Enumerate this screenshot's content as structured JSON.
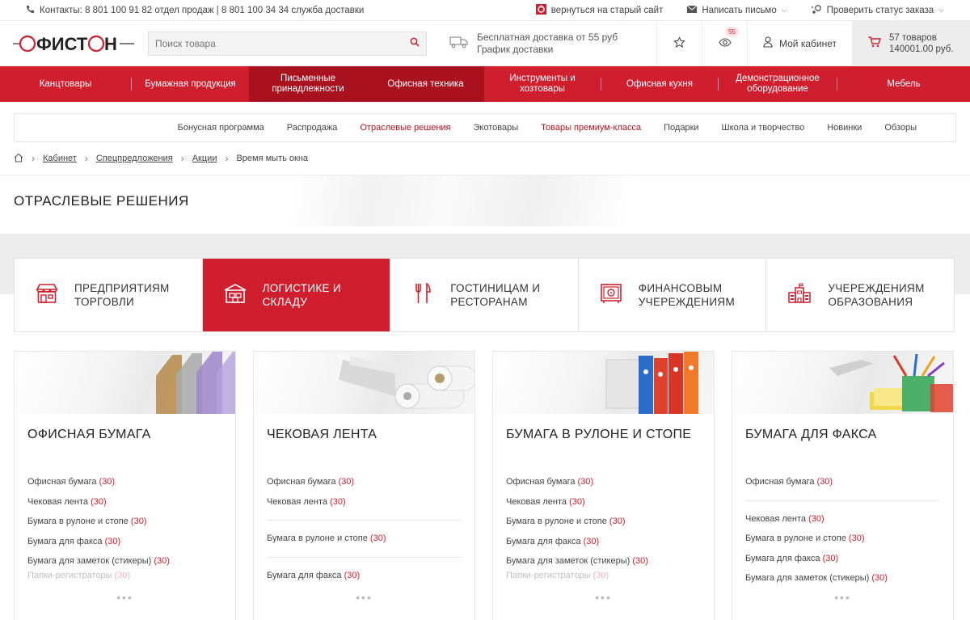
{
  "topbar": {
    "contacts": "Контакты: 8 801 100 91 82 отдел продаж  |  8 801 100 34 34 служба доставки",
    "old_site": "вернуться на старый сайт",
    "write_letter": "Написать письмо",
    "order_status": "Проверить статус заказа"
  },
  "header": {
    "logo_text": "ОФИСТОН",
    "search_placeholder": "Поиск товара",
    "delivery_line1": "Бесплатная доставка от 55 руб",
    "delivery_line2": "График доставки",
    "views_badge": "55",
    "cabinet": "Мой кабинет",
    "cart_count": "57 товаров",
    "cart_sum": "140001.00 руб."
  },
  "main_nav": [
    "Канцтовары",
    "Бумажная продукция",
    "Письменные принадлежности",
    "Офисная техника",
    "Инструменты и хозтовары",
    "Офисная кухня",
    "Демонстрационное оборудование",
    "Мебель"
  ],
  "sub_nav": [
    "Бонусная программа",
    "Распродажа",
    "Отраслевые решения",
    "Экотовары",
    "Товары премиум-класса",
    "Подарки",
    "Школа и творчество",
    "Новинки",
    "Обзоры"
  ],
  "breadcrumbs": [
    "Кабинет",
    "Спецпредложения",
    "Акции",
    "Время мыть окна"
  ],
  "page_title": "ОТРАСЛЕВЫЕ РЕШЕНИЯ",
  "segments": [
    {
      "line1": "ПРЕДПРИЯТИЯМ",
      "line2": "ТОРГОВЛИ",
      "icon": "shop-icon"
    },
    {
      "line1": "ЛОГИСТИКЕ И",
      "line2": "СКЛАДУ",
      "icon": "warehouse-icon"
    },
    {
      "line1": "ГОСТИНИЦАМ И",
      "line2": "РЕСТОРАНАМ",
      "icon": "cutlery-icon"
    },
    {
      "line1": "ФИНАНСОВЫМ",
      "line2": "УЧЕРЕЖДЕНИЯМ",
      "icon": "safe-icon"
    },
    {
      "line1": "УЧЕРЕЖДЕНИЯМ",
      "line2": "ОБРАЗОВАНИЯ",
      "icon": "school-icon"
    }
  ],
  "cards": [
    {
      "title": "ОФИСНАЯ БУМАГА",
      "items": [
        {
          "label": "Офисная бумага",
          "count": "(30)"
        },
        {
          "label": "Чековая лента",
          "count": "(30)"
        },
        {
          "label": "Бумага в рулоне и стопе",
          "count": "(30)"
        },
        {
          "label": "Бумага для факса",
          "count": "(30)"
        },
        {
          "label": "Бумага для заметок (стикеры)",
          "count": "(30)"
        },
        {
          "label": "Папки-регистраторы",
          "count": "(30)"
        }
      ]
    },
    {
      "title": "ЧЕКОВАЯ ЛЕНТА",
      "items": [
        {
          "label": "Офисная бумага",
          "count": "(30)"
        },
        {
          "label": "Чековая лента",
          "count": "(30)"
        },
        {
          "label": "Бумага в рулоне и стопе",
          "count": "(30)"
        },
        {
          "label": "Бумага для факса",
          "count": "(30)"
        }
      ]
    },
    {
      "title": "БУМАГА В РУЛОНЕ И СТОПЕ",
      "items": [
        {
          "label": "Офисная бумага",
          "count": "(30)"
        },
        {
          "label": "Чековая лента",
          "count": "(30)"
        },
        {
          "label": "Бумага в рулоне и стопе",
          "count": "(30)"
        },
        {
          "label": "Бумага для факса",
          "count": "(30)"
        },
        {
          "label": "Бумага для заметок (стикеры)",
          "count": "(30)"
        },
        {
          "label": "Папки-регистраторы",
          "count": "(30)"
        }
      ]
    },
    {
      "title": "БУМАГА ДЛЯ ФАКСА",
      "items": [
        {
          "label": "Офисная бумага",
          "count": "(30)"
        },
        {
          "label": "Чековая лента",
          "count": "(30)"
        },
        {
          "label": "Бумага в рулоне и стопе",
          "count": "(30)"
        },
        {
          "label": "Бумага для факса",
          "count": "(30)"
        },
        {
          "label": "Бумага для заметок (стикеры)",
          "count": "(30)"
        }
      ]
    }
  ],
  "more_dots": "•••",
  "colors": {
    "brand_red": "#cf1e2e",
    "dark_red": "#a9111e"
  }
}
